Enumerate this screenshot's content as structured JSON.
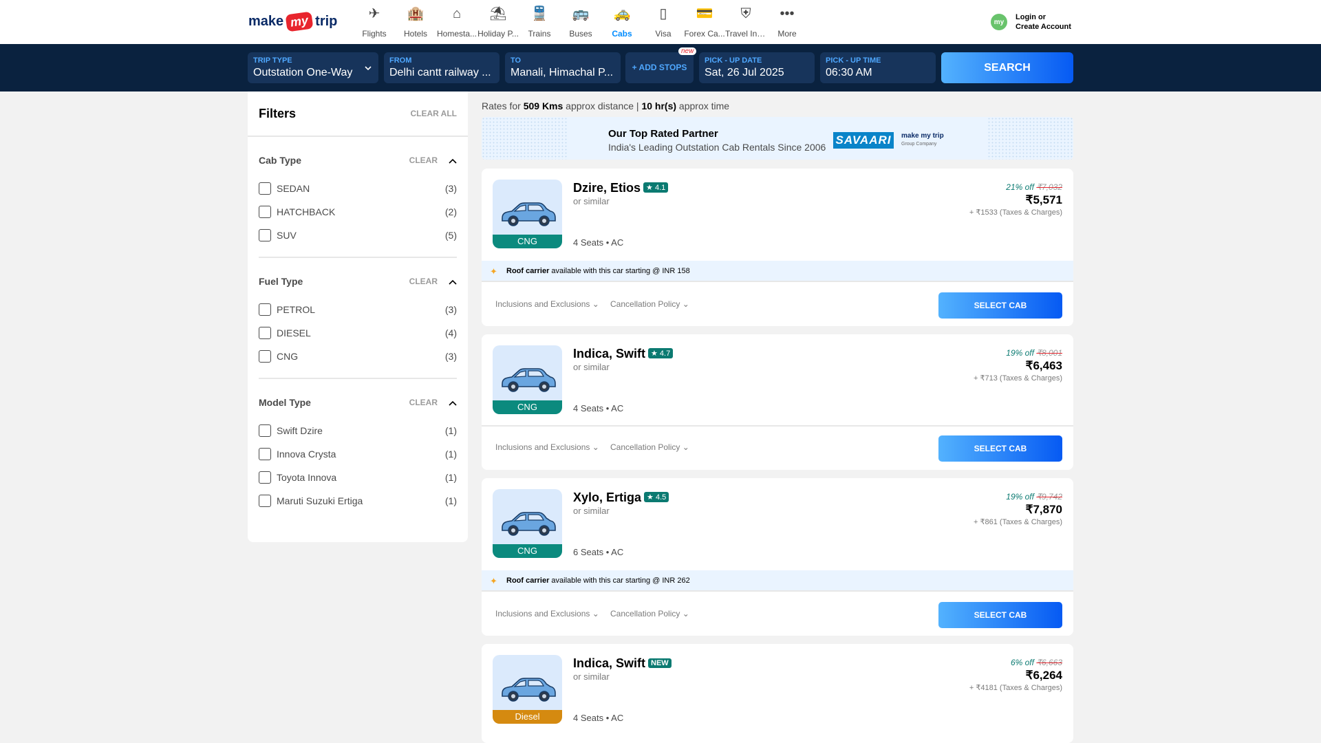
{
  "header": {
    "logo": {
      "make": "make",
      "my": "my",
      "trip": "trip"
    },
    "nav": [
      {
        "label": "Flights",
        "icon": "flights-icon",
        "glyph": "✈"
      },
      {
        "label": "Hotels",
        "icon": "hotels-icon",
        "glyph": "🏨"
      },
      {
        "label": "Homesta...",
        "icon": "homestays-icon",
        "glyph": "⌂"
      },
      {
        "label": "Holiday P...",
        "icon": "holiday-packages-icon",
        "glyph": "⛱"
      },
      {
        "label": "Trains",
        "icon": "trains-icon",
        "glyph": "🚆"
      },
      {
        "label": "Buses",
        "icon": "buses-icon",
        "glyph": "🚌"
      },
      {
        "label": "Cabs",
        "icon": "cabs-icon",
        "glyph": "🚕"
      },
      {
        "label": "Visa",
        "icon": "visa-icon",
        "glyph": "▯"
      },
      {
        "label": "Forex Ca...",
        "icon": "forex-card-icon",
        "glyph": "💳"
      },
      {
        "label": "Travel Ins...",
        "icon": "travel-insurance-icon",
        "glyph": "⛨"
      },
      {
        "label": "More",
        "icon": "more-icon",
        "glyph": "•••"
      }
    ],
    "avatar": "my",
    "login_line1": "Login or",
    "login_line2": "Create Account"
  },
  "search": {
    "trip_type_label": "TRIP TYPE",
    "trip_type_value": "Outstation One-Way",
    "from_label": "FROM",
    "from_value": "Delhi cantt railway ...",
    "to_label": "TO",
    "to_value": "Manali, Himachal P...",
    "add_stops": "+ ADD STOPS",
    "new_tag": "new",
    "pickup_date_label": "PICK - UP DATE",
    "pickup_date_value": "Sat, 26 Jul 2025",
    "pickup_time_label": "PICK - UP TIME",
    "pickup_time_value": "06:30 AM",
    "search_button": "SEARCH"
  },
  "filters": {
    "title": "Filters",
    "clear_all": "CLEAR ALL",
    "clear": "CLEAR",
    "sections": [
      {
        "title": "Cab Type",
        "options": [
          [
            "SEDAN",
            "(3)"
          ],
          [
            "HATCHBACK",
            "(2)"
          ],
          [
            "SUV",
            "(5)"
          ]
        ]
      },
      {
        "title": "Fuel Type",
        "options": [
          [
            "PETROL",
            "(3)"
          ],
          [
            "DIESEL",
            "(4)"
          ],
          [
            "CNG",
            "(3)"
          ]
        ]
      },
      {
        "title": "Model Type",
        "options": [
          [
            "Swift Dzire",
            "(1)"
          ],
          [
            "Innova Crysta",
            "(1)"
          ],
          [
            "Toyota Innova",
            "(1)"
          ],
          [
            "Maruti Suzuki Ertiga",
            "(1)"
          ]
        ]
      }
    ]
  },
  "rates": {
    "prefix": "Rates for ",
    "distance": "509 Kms",
    "mid": " approx distance | ",
    "time": "10 hr(s)",
    "suffix": " approx time"
  },
  "partner": {
    "title": "Our Top Rated Partner",
    "subtitle": "India's Leading Outstation Cab Rentals Since 2006",
    "brand": "SAVAARI",
    "group_brand": "make my trip",
    "group_sub": "Group Company"
  },
  "cards": [
    {
      "name": "Dzire, Etios",
      "rating": "★ 4.1",
      "similar": "or similar",
      "seats": "4 Seats • AC",
      "fuel": "CNG",
      "fuel_color": "#0b8a7e",
      "discount": "21% off",
      "original": "₹7,032",
      "price": "₹5,571",
      "taxes": "+ ₹1533 (Taxes & Charges)",
      "roof": {
        "bold": "Roof carrier",
        "text": " available with this car starting @ INR 158"
      },
      "inclusions": "Inclusions and Exclusions",
      "cancellation": "Cancellation Policy",
      "select": "SELECT CAB"
    },
    {
      "name": "Indica, Swift",
      "rating": "★ 4.7",
      "similar": "or similar",
      "seats": "4 Seats • AC",
      "fuel": "CNG",
      "fuel_color": "#0b8a7e",
      "discount": "19% off",
      "original": "₹8,001",
      "price": "₹6,463",
      "taxes": "+ ₹713 (Taxes & Charges)",
      "inclusions": "Inclusions and Exclusions",
      "cancellation": "Cancellation Policy",
      "select": "SELECT CAB"
    },
    {
      "name": "Xylo, Ertiga",
      "rating": "★ 4.5",
      "similar": "or similar",
      "seats": "6 Seats • AC",
      "fuel": "CNG",
      "fuel_color": "#0b8a7e",
      "discount": "19% off",
      "original": "₹9,742",
      "price": "₹7,870",
      "taxes": "+ ₹861 (Taxes & Charges)",
      "roof": {
        "bold": "Roof carrier",
        "text": " available with this car starting @ INR 262"
      },
      "inclusions": "Inclusions and Exclusions",
      "cancellation": "Cancellation Policy",
      "select": "SELECT CAB"
    },
    {
      "name": "Indica, Swift",
      "rating": "NEW",
      "similar": "or similar",
      "seats": "4 Seats • AC",
      "fuel": "Diesel",
      "fuel_color": "#d58a10",
      "discount": "6% off",
      "original": "₹6,663",
      "price": "₹6,264",
      "taxes": "+ ₹4181 (Taxes & Charges)"
    }
  ],
  "colors": {
    "accent": "#008cff",
    "navy": "#0a223f",
    "teal": "#0b7a71"
  }
}
